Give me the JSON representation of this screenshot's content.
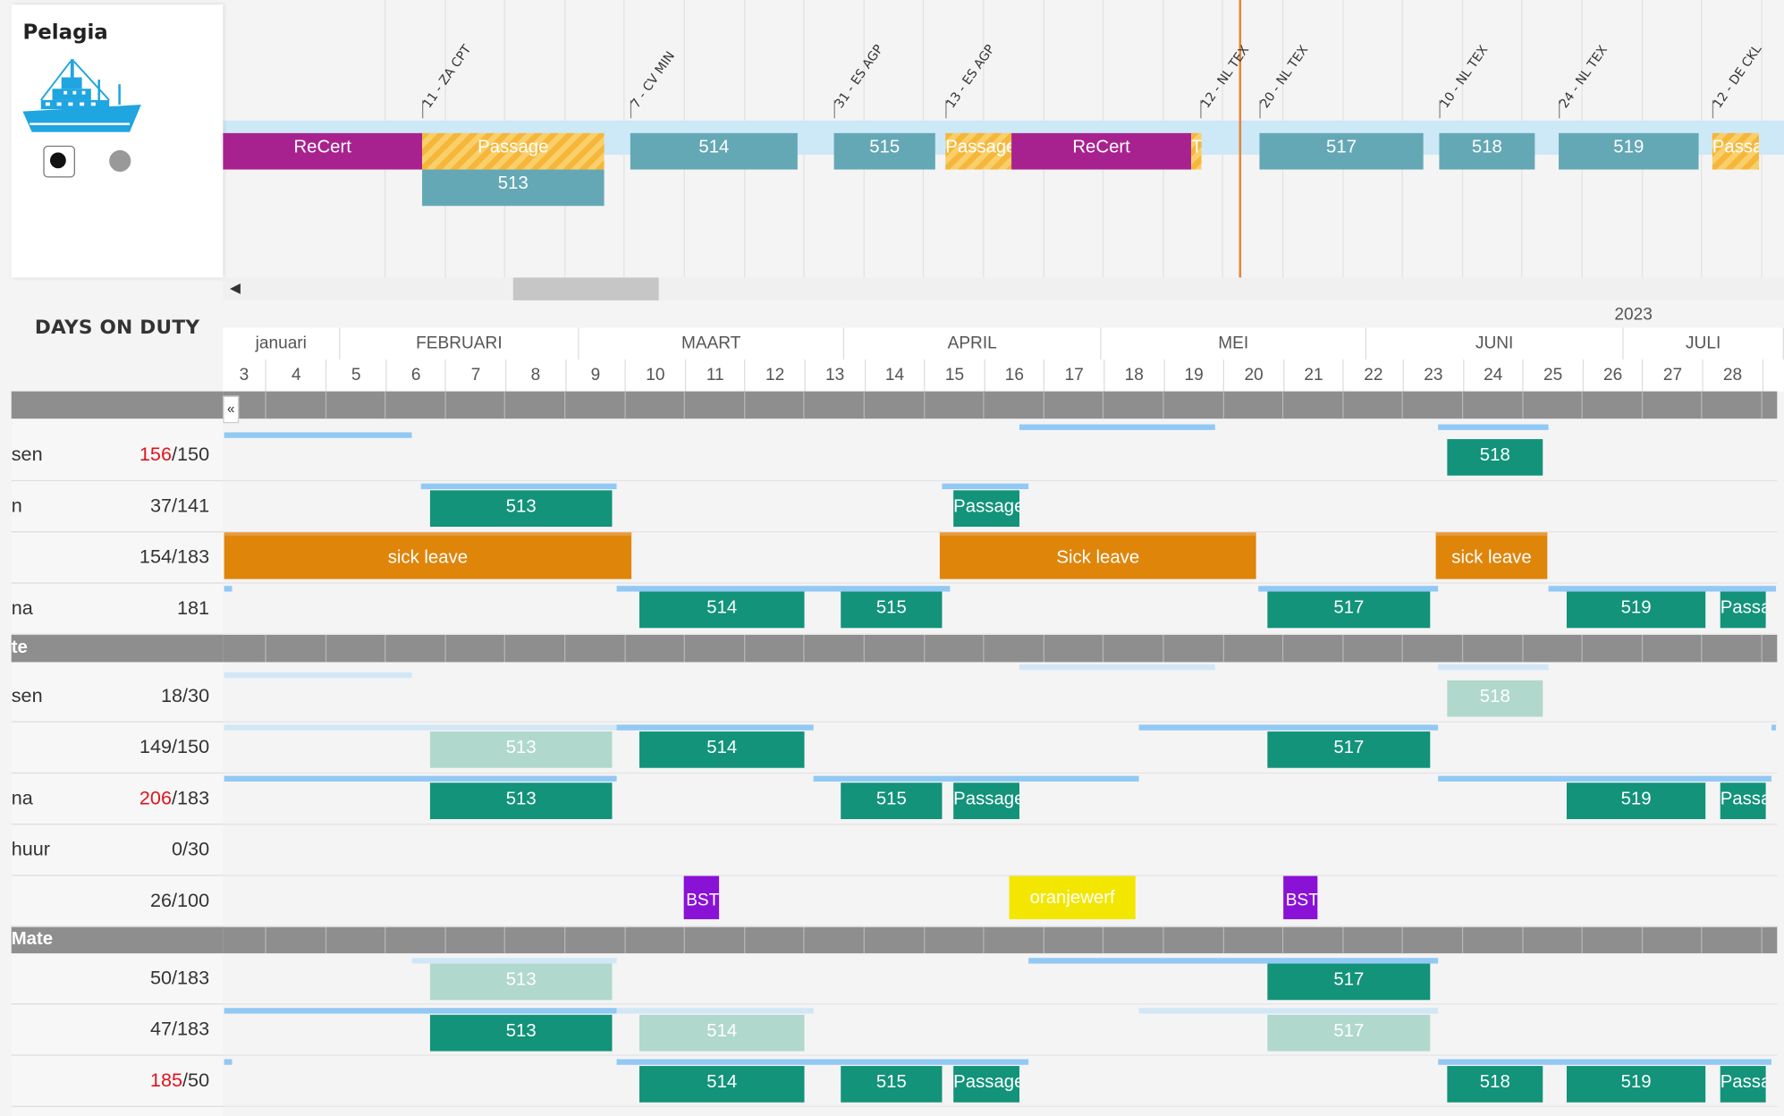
{
  "vessel": {
    "name": "Pelagia",
    "ship_icon": "ship-icon",
    "radio_selected": "filled",
    "radio_other": "empty"
  },
  "port_calls": [
    "11 - ZA CPT",
    "7 - CV MIN",
    "31 - ES AGP",
    "13 - ES AGP",
    "12 - NL TEX",
    "20 - NL TEX",
    "10 - NL TEX",
    "24 - NL TEX",
    "12 - DE CKL"
  ],
  "voyages": [
    "ReCert",
    "Passage",
    "513",
    "514",
    "515",
    "Passage",
    "ReCert",
    "T",
    "517",
    "518",
    "519",
    "Passa"
  ],
  "days_on_duty": {
    "title": "DAYS ON DUTY",
    "year": "2023"
  },
  "months": [
    "januari",
    "FEBRUARI",
    "MAART",
    "APRIL",
    "MEI",
    "JUNI",
    "JULI"
  ],
  "weeks": [
    "3",
    "4",
    "5",
    "6",
    "7",
    "8",
    "9",
    "10",
    "11",
    "12",
    "13",
    "14",
    "15",
    "16",
    "17",
    "18",
    "19",
    "20",
    "21",
    "22",
    "23",
    "24",
    "25",
    "26",
    "27",
    "28"
  ],
  "collapse_label": "«",
  "sections": {
    "s2": "te",
    "s3": "Mate"
  },
  "people": [
    {
      "name": "sen",
      "used": "156",
      "total": "/150",
      "over": true
    },
    {
      "name": "n",
      "used": "37/141",
      "total": "",
      "over": false
    },
    {
      "name": "",
      "used": "154/183",
      "total": "",
      "over": false
    },
    {
      "name": "na",
      "used": "181",
      "total": "",
      "over": false
    },
    {
      "name": "sen",
      "used": "18/30",
      "total": "",
      "over": false
    },
    {
      "name": "",
      "used": "149/150",
      "total": "",
      "over": false
    },
    {
      "name": "na",
      "used": "206",
      "total": "/183",
      "over": true
    },
    {
      "name": "huur",
      "used": "0/30",
      "total": "",
      "over": false
    },
    {
      "name": "",
      "used": "26/100",
      "total": "",
      "over": false
    },
    {
      "name": "",
      "used": "50/183",
      "total": "",
      "over": false
    },
    {
      "name": "",
      "used": "47/183",
      "total": "",
      "over": false
    },
    {
      "name": "",
      "used": "185",
      "total": "/50",
      "over": true
    }
  ],
  "assignments": {
    "r1": [
      "518"
    ],
    "r2": [
      "513",
      "Passage"
    ],
    "r3": [
      "sick leave",
      "Sick leave",
      "sick leave"
    ],
    "r4": [
      "514",
      "515",
      "517",
      "519",
      "Passa"
    ],
    "r5": [
      "518"
    ],
    "r6": [
      "513",
      "514",
      "517"
    ],
    "r7": [
      "513",
      "515",
      "Passage",
      "519",
      "Passa"
    ],
    "r9": [
      "BST",
      "oranjewerf",
      "BST"
    ],
    "r10": [
      "513",
      "517"
    ],
    "r11": [
      "513",
      "514",
      "517"
    ],
    "r12": [
      "514",
      "515",
      "Passage",
      "518",
      "519",
      "Passa"
    ]
  },
  "colors": {
    "voyage": "#64a8b5",
    "recert": "#a8228f",
    "assignment": "#12937a",
    "sick_leave": "#df850a",
    "training": "#8a11d6",
    "yard": "#f3e600",
    "today": "#e0873a"
  }
}
